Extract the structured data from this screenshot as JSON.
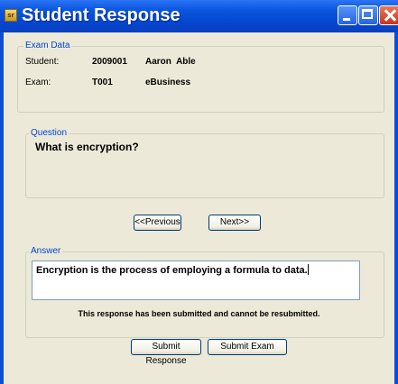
{
  "window": {
    "title": "Student Response",
    "icon": "app-icon",
    "controls": [
      "minimize-icon",
      "maximize-icon",
      "close-icon"
    ]
  },
  "exam_data": {
    "group_label": "Exam Data",
    "student_label": "Student:",
    "student_id": "2009001",
    "student_name": "Aaron  Able",
    "exam_label": "Exam:",
    "exam_id": "T001",
    "exam_name": "eBusiness"
  },
  "question": {
    "group_label": "Question",
    "text": "What is encryption?"
  },
  "navigation": {
    "previous_label": "<<Previous",
    "next_label": "Next>>"
  },
  "answer": {
    "group_label": "Answer",
    "text": "Encryption is the process of employing a formula to data."
  },
  "notice": "This response has been submitted and cannot be resubmitted.",
  "actions": {
    "submit_response_label": "Submit Response",
    "submit_exam_label": "Submit Exam"
  },
  "colors": {
    "titlebar": "#0a4fd6",
    "client_background": "#ece9d8",
    "group_label": "#0046d5"
  }
}
